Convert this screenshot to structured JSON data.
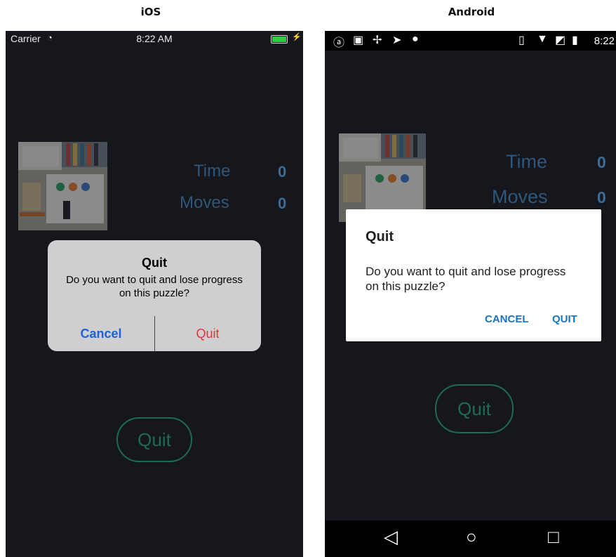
{
  "captions": {
    "ios": "iOS",
    "android": "Android"
  },
  "ios": {
    "status": {
      "carrier": "Carrier",
      "wifi_icon": "wifi-icon",
      "time": "8:22 AM",
      "battery_icon": "battery-charging-icon"
    },
    "stats": {
      "time_label": "Time",
      "time_value": "0",
      "moves_label": "Moves",
      "moves_value": "0"
    },
    "quit_button": "Quit",
    "alert": {
      "title": "Quit",
      "message": "Do you want to quit and lose progress on this puzzle?",
      "cancel": "Cancel",
      "quit": "Quit"
    }
  },
  "android": {
    "status": {
      "time": "8:22",
      "icons": [
        "app-icon",
        "image-icon",
        "pinwheel-icon",
        "send-icon",
        "android-icon",
        "vibrate-icon",
        "wifi-icon",
        "no-sim-icon",
        "battery-charging-icon"
      ]
    },
    "stats": {
      "time_label": "Time",
      "time_value": "0",
      "moves_label": "Moves",
      "moves_value": "0"
    },
    "quit_button": "Quit",
    "dialog": {
      "title": "Quit",
      "message": "Do you want to quit and lose progress on this puzzle?",
      "cancel": "CANCEL",
      "quit": "QUIT"
    },
    "navbar": {
      "back_icon": "back-icon",
      "home_icon": "home-icon",
      "recents_icon": "recents-icon"
    }
  },
  "colors": {
    "background": "#15171c",
    "stat_text": "#305679",
    "quit_accent": "#1f6a55",
    "ios_cancel": "#1a63d8",
    "ios_quit": "#e8313a",
    "android_button": "#1a73c0"
  }
}
